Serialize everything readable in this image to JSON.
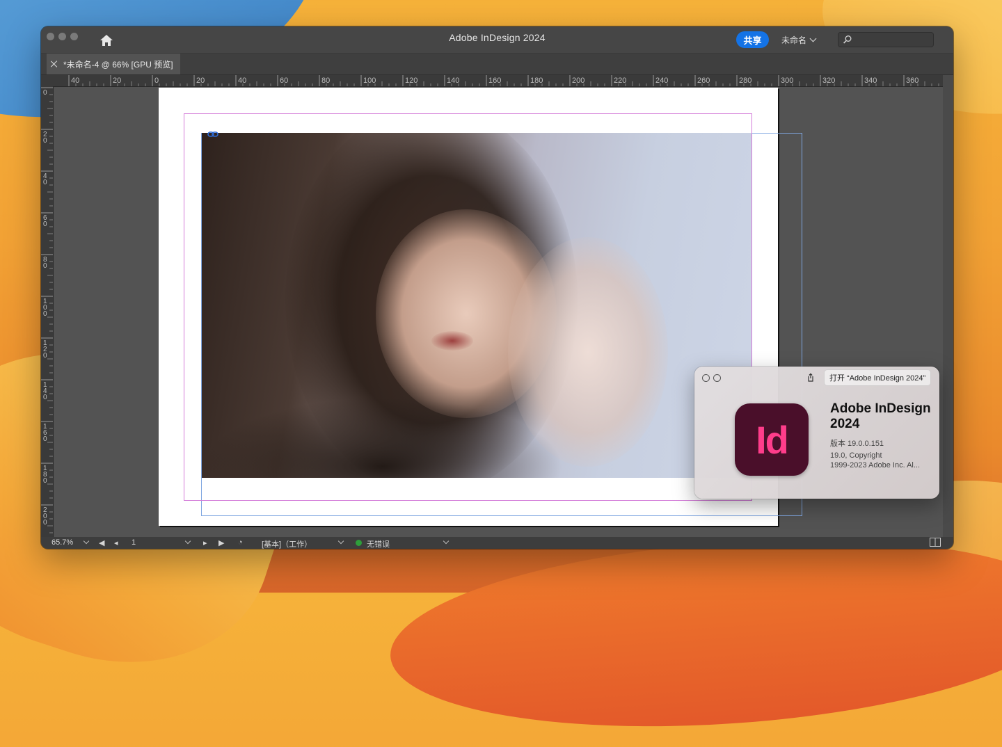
{
  "window": {
    "title": "Adobe InDesign 2024",
    "share_label": "共享",
    "workspace_label": "未命名",
    "search_placeholder": ""
  },
  "tab": {
    "label": "*未命名-4 @ 66% [GPU 预览]"
  },
  "rulers": {
    "horizontal": [
      "40",
      "20",
      "0",
      "20",
      "40",
      "60",
      "80",
      "100",
      "120",
      "140",
      "160",
      "180",
      "200",
      "220",
      "240",
      "260",
      "280",
      "300",
      "320",
      "340",
      "360"
    ],
    "vertical": [
      "0",
      "20",
      "40",
      "60",
      "80",
      "100",
      "120",
      "140",
      "160",
      "180",
      "200"
    ]
  },
  "status": {
    "zoom": "65.7%",
    "page": "1",
    "master": "[基本]（工作）",
    "preflight": "无错误"
  },
  "about": {
    "open_label": "打开 “Adobe InDesign 2024”",
    "icon_text": "Id",
    "name": "Adobe InDesign 2024",
    "version": "版本 19.0.0.151",
    "copyright_1": "19.0, Copyright",
    "copyright_2": "1999-2023 Adobe Inc. Al..."
  },
  "colors": {
    "accent": "#1473e6",
    "indesign_bg": "#4a0f2a",
    "indesign_fg": "#ff3d8b",
    "margin_guide": "#d37ad8",
    "frame_guide": "#7fa6e0"
  }
}
